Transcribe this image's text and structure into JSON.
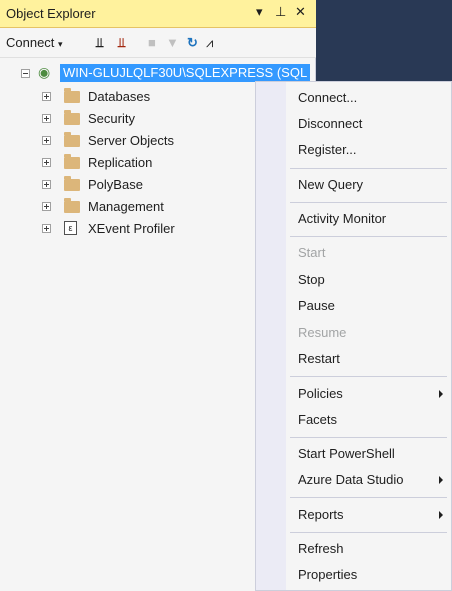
{
  "window": {
    "title": "Object Explorer"
  },
  "toolbar": {
    "connect_label": "Connect"
  },
  "tree": {
    "server": "WIN-GLUJLQLF30U\\SQLEXPRESS (SQL",
    "children": [
      "Databases",
      "Security",
      "Server Objects",
      "Replication",
      "PolyBase",
      "Management",
      "XEvent Profiler"
    ]
  },
  "menu": {
    "connect": "Connect...",
    "disconnect": "Disconnect",
    "register": "Register...",
    "new_query": "New Query",
    "activity_monitor": "Activity Monitor",
    "start": "Start",
    "stop": "Stop",
    "pause": "Pause",
    "resume": "Resume",
    "restart": "Restart",
    "policies": "Policies",
    "facets": "Facets",
    "start_powershell": "Start PowerShell",
    "azure_data_studio": "Azure Data Studio",
    "reports": "Reports",
    "refresh": "Refresh",
    "properties": "Properties"
  },
  "colors": {
    "title_bar": "#fff29d",
    "selection": "#3399ff",
    "dark_bg": "#293955",
    "folder": "#dcb67a"
  }
}
